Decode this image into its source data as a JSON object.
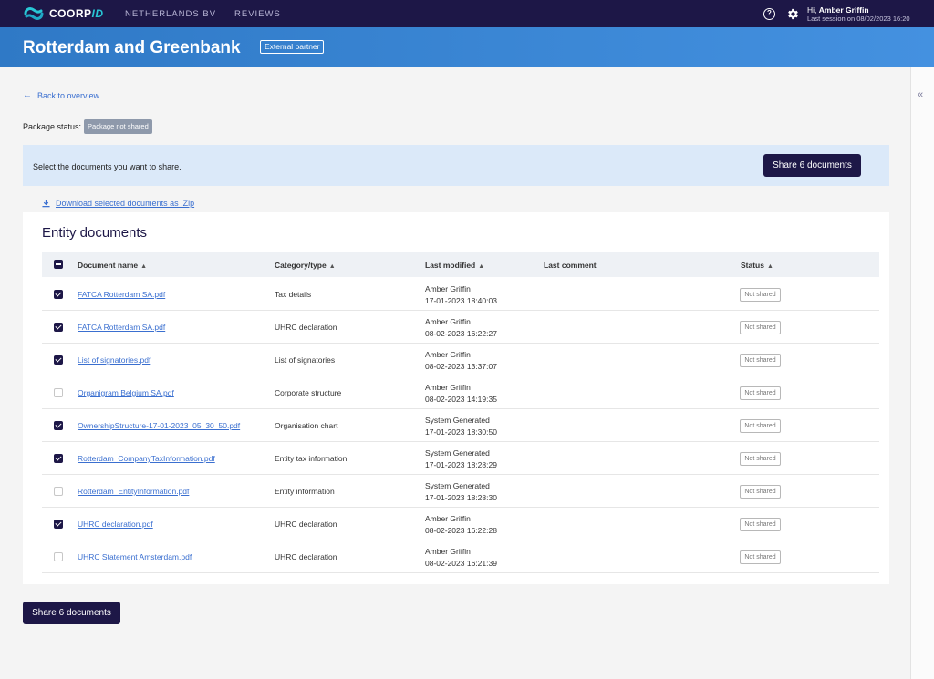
{
  "topbar": {
    "logo_text": "COORP",
    "logo_accent": "ID",
    "nav": [
      "NETHERLANDS BV",
      "REVIEWS"
    ],
    "help_icon": "help-circle-icon",
    "settings_icon": "gear-icon",
    "greeting": "Hi,",
    "user_name": "Amber Griffin",
    "last_session": "Last session on  08/02/2023 16:20"
  },
  "header": {
    "title": "Rotterdam and Greenbank",
    "badge": "External partner"
  },
  "sidebar": {
    "toggle": "«"
  },
  "back_link": "Back to overview",
  "package_status": {
    "label": "Package status:",
    "value": "Package not shared"
  },
  "share_banner": {
    "text": "Select the documents you want to share.",
    "button": "Share 6 documents"
  },
  "download_link": "Download selected documents as .Zip",
  "documents": {
    "title": "Entity documents",
    "columns": {
      "name": "Document name",
      "category": "Category/type",
      "modified": "Last modified",
      "comment": "Last comment",
      "status": "Status"
    },
    "rows": [
      {
        "checked": true,
        "name": "FATCA Rotterdam SA.pdf",
        "category": "Tax details",
        "by": "Amber Griffin",
        "date": "17-01-2023 18:40:03",
        "comment": "",
        "status": "Not shared"
      },
      {
        "checked": true,
        "name": "FATCA Rotterdam SA.pdf",
        "category": "UHRC declaration",
        "by": "Amber Griffin",
        "date": "08-02-2023 16:22:27",
        "comment": "",
        "status": "Not shared"
      },
      {
        "checked": true,
        "name": "List of signatories.pdf",
        "category": "List of signatories",
        "by": "Amber Griffin",
        "date": "08-02-2023 13:37:07",
        "comment": "",
        "status": "Not shared"
      },
      {
        "checked": false,
        "name": "Organigram Belgium SA.pdf",
        "category": "Corporate structure",
        "by": "Amber Griffin",
        "date": "08-02-2023 14:19:35",
        "comment": "",
        "status": "Not shared"
      },
      {
        "checked": true,
        "name": "OwnershipStructure-17-01-2023_05_30_50.pdf",
        "category": "Organisation chart",
        "by": "System Generated",
        "date": "17-01-2023 18:30:50",
        "comment": "",
        "status": "Not shared"
      },
      {
        "checked": true,
        "name": "Rotterdam_CompanyTaxInformation.pdf",
        "category": "Entity tax information",
        "by": "System Generated",
        "date": "17-01-2023 18:28:29",
        "comment": "",
        "status": "Not shared"
      },
      {
        "checked": false,
        "name": "Rotterdam_EntityInformation.pdf",
        "category": "Entity information",
        "by": "System Generated",
        "date": "17-01-2023 18:28:30",
        "comment": "",
        "status": "Not shared"
      },
      {
        "checked": true,
        "name": "UHRC declaration.pdf",
        "category": "UHRC declaration",
        "by": "Amber Griffin",
        "date": "08-02-2023 16:22:28",
        "comment": "",
        "status": "Not shared"
      },
      {
        "checked": false,
        "name": "UHRC Statement Amsterdam.pdf",
        "category": "UHRC declaration",
        "by": "Amber Griffin",
        "date": "08-02-2023 16:21:39",
        "comment": "",
        "status": "Not shared"
      }
    ]
  },
  "footer_button": "Share 6 documents",
  "colors": {
    "nav_bg": "#1d1747",
    "header_bg": "#3a86d6",
    "accent": "#28c7d6",
    "link": "#3a6fd0",
    "primary_button": "#1d1747",
    "banner_bg": "#dbe9f9"
  }
}
